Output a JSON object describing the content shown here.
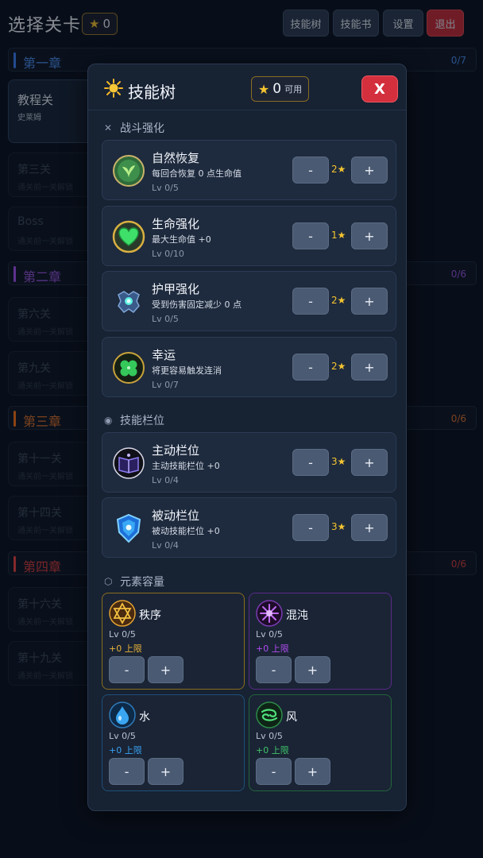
{
  "header": {
    "title": "选择关卡",
    "stars": "0",
    "buttons": {
      "skill_tree": "技能树",
      "skill_book": "技能书",
      "settings": "设置",
      "exit": "退出"
    }
  },
  "chapters": [
    {
      "name": "第一章",
      "count": "0/7",
      "color": "#3b82f6"
    },
    {
      "name": "第二章",
      "count": "0/6",
      "color": "#a855f7"
    },
    {
      "name": "第三章",
      "count": "0/6",
      "color": "#f97316"
    },
    {
      "name": "第四章",
      "count": "0/6",
      "color": "#ef4444"
    }
  ],
  "stages": [
    {
      "name": "教程关",
      "sub": "史莱姆"
    },
    {
      "name": "第三关",
      "sub": "通关前一关解锁"
    },
    {
      "name": "Boss",
      "sub": "通关前一关解锁"
    },
    {
      "name": "第六关",
      "sub": "通关前一关解锁"
    },
    {
      "name": "第九关",
      "sub": "通关前一关解锁"
    },
    {
      "name": "第十一关",
      "sub": "通关前一关解锁"
    },
    {
      "name": "第十四关",
      "sub": "通关前一关解锁"
    },
    {
      "name": "第十六关",
      "sub": "通关前一关解锁"
    },
    {
      "name": "第十九关",
      "sub": "通关前一关解锁"
    }
  ],
  "modal": {
    "title": "技能树",
    "available_stars": "0",
    "available_label": "可用",
    "close_label": "X",
    "sections": {
      "combat": "战斗强化",
      "slots": "技能栏位",
      "elements": "元素容量"
    },
    "combat_skills": [
      {
        "name": "自然恢复",
        "desc": "每回合恢复 0 点生命值",
        "level": "Lv 0/5",
        "cost": "2★",
        "icon": "leaf-icon"
      },
      {
        "name": "生命强化",
        "desc": "最大生命值 +0",
        "level": "Lv 0/10",
        "cost": "1★",
        "icon": "heart-icon"
      },
      {
        "name": "护甲强化",
        "desc": "受到伤害固定减少 0 点",
        "level": "Lv 0/5",
        "cost": "2★",
        "icon": "armor-icon"
      },
      {
        "name": "幸运",
        "desc": "将更容易触发连消",
        "level": "Lv 0/7",
        "cost": "2★",
        "icon": "clover-icon"
      }
    ],
    "slot_skills": [
      {
        "name": "主动栏位",
        "desc": "主动技能栏位 +0",
        "level": "Lv 0/4",
        "cost": "3★",
        "icon": "book-icon"
      },
      {
        "name": "被动栏位",
        "desc": "被动技能栏位 +0",
        "level": "Lv 0/4",
        "cost": "3★",
        "icon": "shield-icon"
      }
    ],
    "elements": [
      {
        "name": "秩序",
        "level": "Lv 0/5",
        "cap": "+0 上限",
        "color": "#e8b23a",
        "icon": "order-star-icon"
      },
      {
        "name": "混沌",
        "level": "Lv 0/5",
        "cap": "+0 上限",
        "color": "#b04cf0",
        "icon": "chaos-icon"
      },
      {
        "name": "水",
        "level": "Lv 0/5",
        "cap": "+0 上限",
        "color": "#3aa0f0",
        "icon": "water-drop-icon"
      },
      {
        "name": "风",
        "level": "Lv 0/5",
        "cap": "+0 上限",
        "color": "#3fc468",
        "icon": "wind-swirl-icon"
      }
    ],
    "button_minus": "-",
    "button_plus": "+"
  }
}
